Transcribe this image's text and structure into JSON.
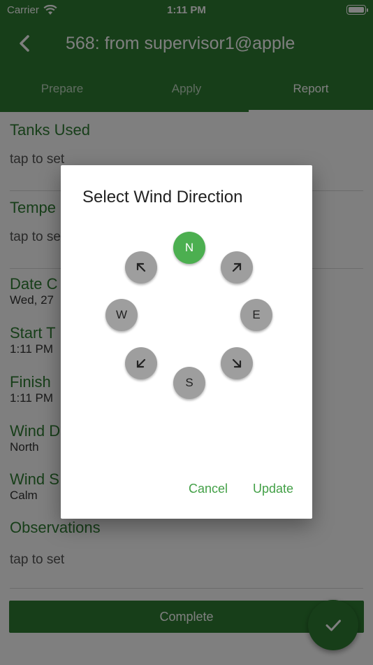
{
  "status": {
    "carrier": "Carrier",
    "time": "1:11 PM"
  },
  "header": {
    "title": "568: from supervisor1@apple"
  },
  "tabs": [
    {
      "label": "Prepare"
    },
    {
      "label": "Apply"
    },
    {
      "label": "Report"
    }
  ],
  "fields": {
    "tanks": {
      "label": "Tanks Used",
      "value": "tap to set"
    },
    "temperature": {
      "label": "Tempe",
      "value": "tap to se"
    },
    "date": {
      "label": "Date C",
      "value": "Wed, 27"
    },
    "start": {
      "label": "Start T",
      "value": "1:11 PM"
    },
    "finish": {
      "label": "Finish",
      "value": "1:11 PM"
    },
    "wind_dir": {
      "label": "Wind D",
      "value": "North"
    },
    "wind_speed": {
      "label": "Wind S",
      "value": "Calm"
    },
    "observations": {
      "label": "Observations",
      "value": "tap to set"
    }
  },
  "complete_label": "Complete",
  "dialog": {
    "title": "Select Wind Direction",
    "directions": {
      "n": "N",
      "e": "E",
      "s": "S",
      "w": "W"
    },
    "selected": "N",
    "cancel": "Cancel",
    "update": "Update"
  },
  "colors": {
    "primary": "#2e7d32",
    "accent": "#4caf50",
    "button_grey": "#9e9e9e"
  },
  "icons": {
    "back": "chevron-left-icon",
    "wifi": "wifi-icon",
    "check": "check-icon"
  }
}
